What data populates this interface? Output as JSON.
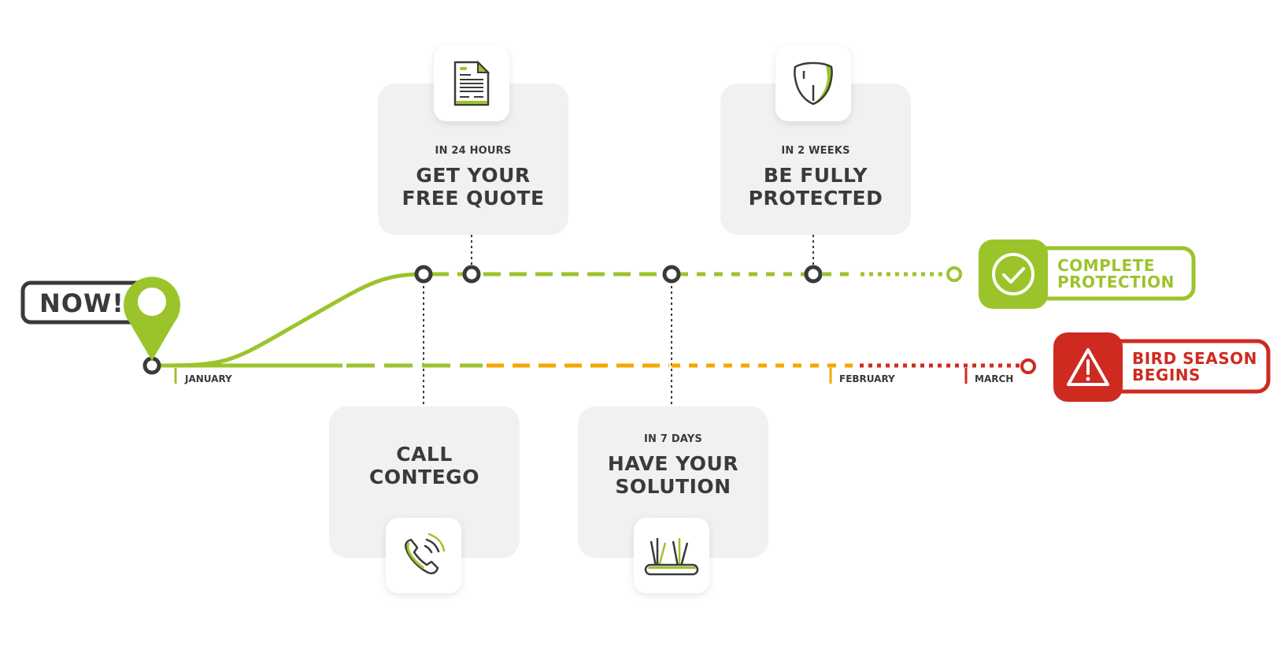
{
  "colors": {
    "green": "#9bc42a",
    "orange": "#f5a700",
    "red": "#cf2a20",
    "dark": "#3a3a3a",
    "card_bg": "#f0f1f1"
  },
  "now_label": "NOW!",
  "months": [
    "JANUARY",
    "FEBRUARY",
    "MARCH"
  ],
  "steps": [
    {
      "id": "call",
      "subtitle": "",
      "title_line1": "CALL",
      "title_line2": "CONTEGO",
      "icon": "phone-icon"
    },
    {
      "id": "quote",
      "subtitle": "IN 24 HOURS",
      "title_line1": "GET YOUR",
      "title_line2": "FREE QUOTE",
      "icon": "document-icon"
    },
    {
      "id": "solution",
      "subtitle": "IN 7 DAYS",
      "title_line1": "HAVE YOUR",
      "title_line2": "SOLUTION",
      "icon": "bird-spikes-icon"
    },
    {
      "id": "protected",
      "subtitle": "IN 2 WEEKS",
      "title_line1": "BE FULLY",
      "title_line2": "PROTECTED",
      "icon": "shield-icon"
    }
  ],
  "outcomes": {
    "complete": {
      "line1": "COMPLETE",
      "line2": "PROTECTION",
      "icon": "check-circle-icon"
    },
    "bird_season": {
      "line1": "BIRD SEASON",
      "line2": "BEGINS",
      "icon": "warning-icon"
    }
  }
}
